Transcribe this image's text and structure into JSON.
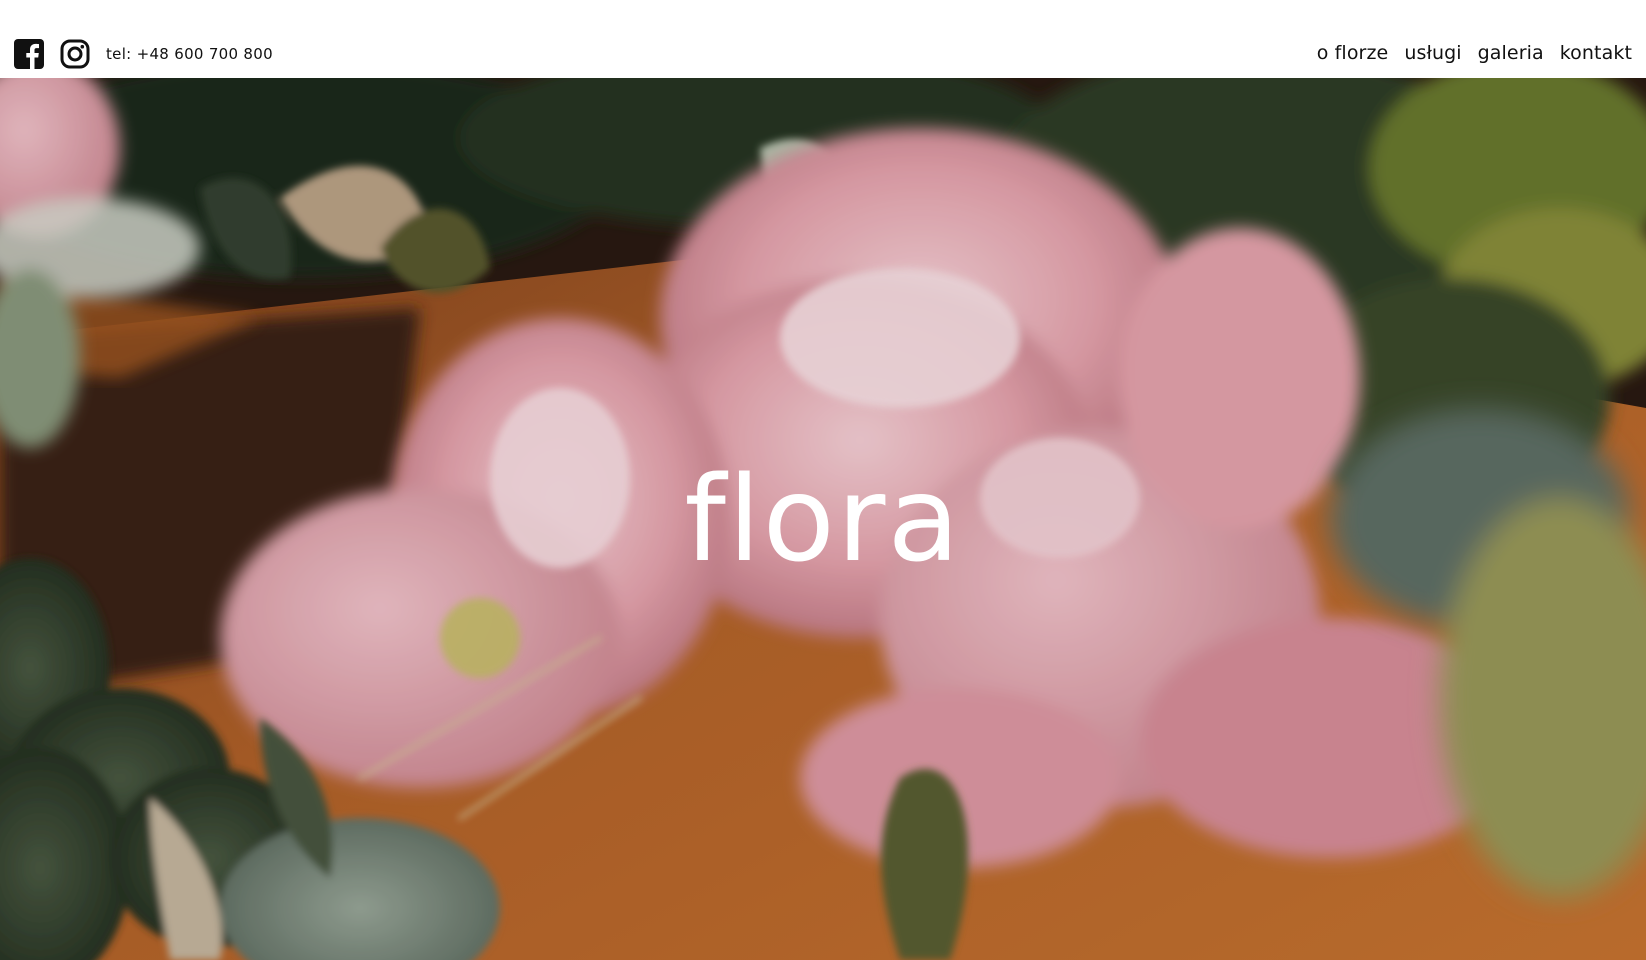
{
  "social": {
    "facebook_icon": "facebook-icon",
    "instagram_icon": "instagram-icon",
    "phone": "tel: +48 600 700 800"
  },
  "nav": {
    "items": [
      {
        "label": "o florze"
      },
      {
        "label": "usługi"
      },
      {
        "label": "galeria"
      },
      {
        "label": "kontakt"
      }
    ]
  },
  "hero": {
    "logo": "flora"
  },
  "colors": {
    "header_bg": "#ffffff",
    "text": "#111111",
    "logo": "#ffffff",
    "wood": "#b5642a",
    "petal": "#e8a6b0",
    "leaf": "#3a4a32"
  }
}
